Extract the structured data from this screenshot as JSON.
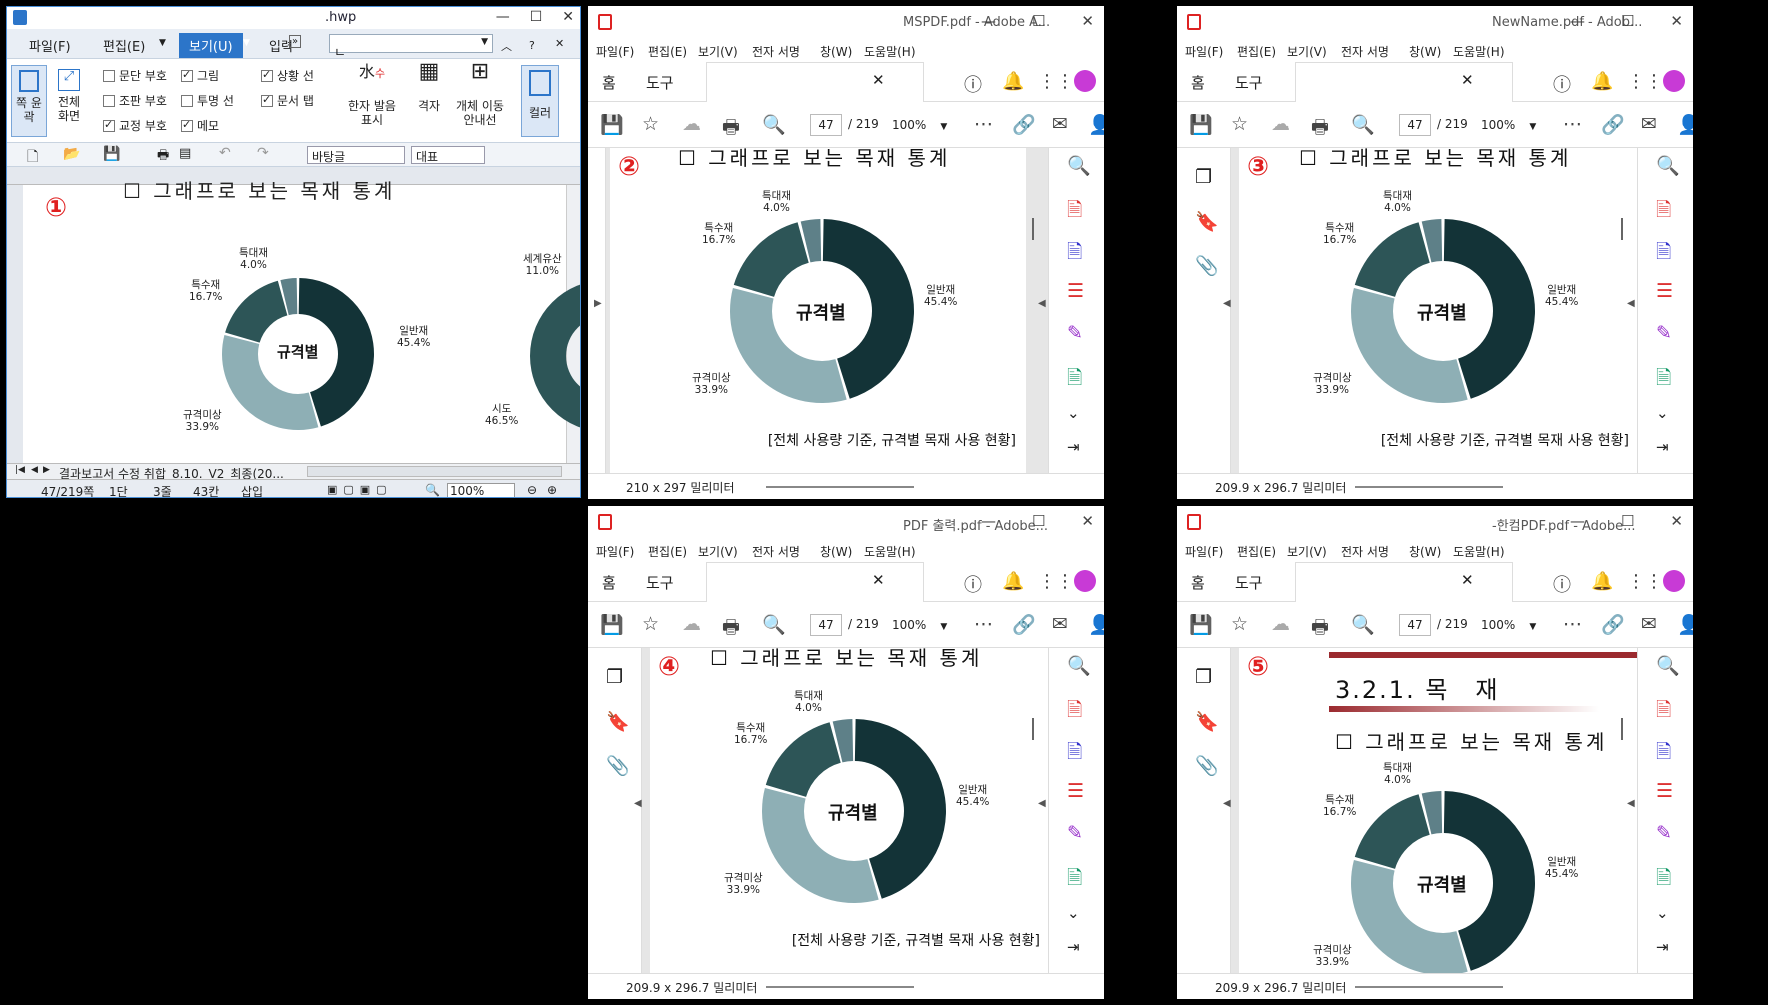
{
  "hwp": {
    "title": ".hwp",
    "menu": [
      "파일(F)",
      "편집(E)",
      "보기(U)",
      "입력"
    ],
    "search_value": "ㄴ",
    "ribbon": {
      "btn1": "쪽 윤곽",
      "btn2": "전체 화면",
      "checks": [
        {
          "label": "문단 부호",
          "on": false
        },
        {
          "label": "그림",
          "on": true
        },
        {
          "label": "조판 부호",
          "on": false
        },
        {
          "label": "투명 선",
          "on": false
        },
        {
          "label": "교정 부호",
          "on": true
        },
        {
          "label": "메모",
          "on": true
        },
        {
          "label": "상황 선",
          "on": true
        },
        {
          "label": "문서 탭",
          "on": true
        }
      ],
      "hanja": "한자 발음 표시",
      "grid": "격자",
      "move": "개체 이동 안내선",
      "color": "컬러"
    },
    "style_dd": "바탕글",
    "para_dd": "대표",
    "circle": "①",
    "tab_name": "결과보고서 수정 취합_8.10._V2_최종(20...",
    "status": {
      "page": "47/219쪽",
      "col": "1단",
      "line": "3줄",
      "char": "43칸",
      "mode": "삽입",
      "zoom": "100%"
    },
    "labels": {
      "special": "특대재\n4.0%",
      "special2": "특수재\n16.7%",
      "general": "일반재\n45.4%",
      "under": "규격미상\n33.9%",
      "heritage": "세계유산\n11.0%",
      "city": "시도\n46.5%"
    },
    "center": "규격별"
  },
  "acro_common": {
    "menu": [
      "파일(F)",
      "편집(E)",
      "보기(V)",
      "전자 서명",
      "창(W)",
      "도움말(H)"
    ],
    "tabs": [
      "홈",
      "도구"
    ],
    "page_num": "47",
    "page_total": "/ 219",
    "zoom": "100%",
    "heading": "☐ 그래프로 보는 목재 통계",
    "caption": "[전체 사용량 기준, 규격별 목재 사용 현황]",
    "center": "규격별",
    "labels": {
      "t": "특대재\n4.0%",
      "s": "특수재\n16.7%",
      "g": "일반재\n45.4%",
      "u": "규격미상\n33.9%"
    }
  },
  "acro_windows": [
    {
      "title": "MSPDF.pdf - Adobe A...",
      "circle": "②",
      "status": "210 x 297 밀리미터"
    },
    {
      "title": "NewName.pdf - Adob...",
      "circle": "③",
      "status": "209.9 x 296.7 밀리미터"
    },
    {
      "title": "PDF 출력.pdf - Adobe...",
      "circle": "④",
      "status": "209.9 x 296.7 밀리미터"
    },
    {
      "title": "-한컴PDF.pdf - Adobe...",
      "circle": "⑤",
      "status": "209.9 x 296.7 밀리미터",
      "section": "3.2.1. 목　재"
    }
  ],
  "chart_data": {
    "type": "pie",
    "title": "규격별",
    "categories": [
      "일반재",
      "규격미상",
      "특수재",
      "특대재"
    ],
    "values": [
      45.4,
      33.9,
      16.7,
      4.0
    ],
    "colors": [
      "#133337",
      "#8eafb5",
      "#2d5557",
      "#5e8088"
    ]
  }
}
